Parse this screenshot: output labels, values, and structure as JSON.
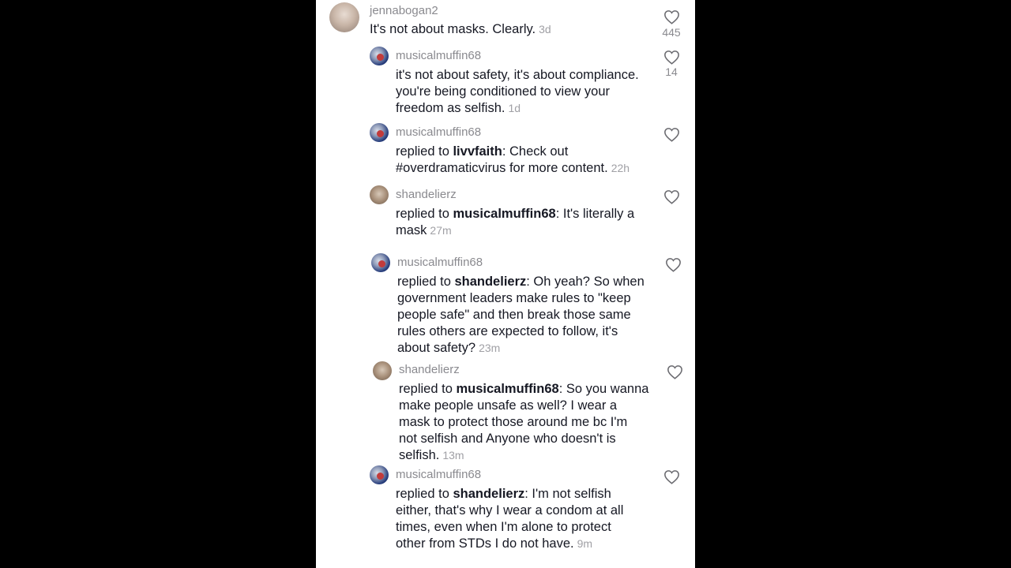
{
  "comments": [
    {
      "username": "jennabogan2",
      "text": "It's not about masks. Clearly.",
      "age": "3d",
      "likes": "445"
    },
    {
      "username": "musicalmuffin68",
      "text": "it's not about safety, it's about compliance.\nyou're being conditioned to view your\nfreedom as selfish.",
      "age": "1d",
      "likes": "14"
    },
    {
      "username": "musicalmuffin68",
      "prefix": "replied to ",
      "mention": "livvfaith",
      "text": ": Check out\n#overdramaticvirus for more content.",
      "age": "22h"
    },
    {
      "username": "shandelierz",
      "prefix": "replied to ",
      "mention": "musicalmuffin68",
      "text": ": It's literally a\nmask",
      "age": "27m"
    },
    {
      "username": "musicalmuffin68",
      "prefix": "replied to ",
      "mention": "shandelierz",
      "text": ": Oh yeah? So when\ngovernment leaders make rules to \"keep\npeople safe\" and then break those same\nrules others are expected to follow, it's\nabout safety?",
      "age": "23m"
    },
    {
      "username": "shandelierz",
      "prefix": "replied to ",
      "mention": "musicalmuffin68",
      "text": ": So you wanna\nmake people unsafe as well? I wear a\nmask to protect those around me bc I'm\nnot selfish and Anyone who doesn't is\nselfish.",
      "age": "13m"
    },
    {
      "username": "musicalmuffin68",
      "prefix": "replied to ",
      "mention": "shandelierz",
      "text": ": I'm not selfish\neither, that's why I wear a condom at all\ntimes, even when I'm alone to protect\nother from STDs I do not have.",
      "age": "9m"
    }
  ]
}
